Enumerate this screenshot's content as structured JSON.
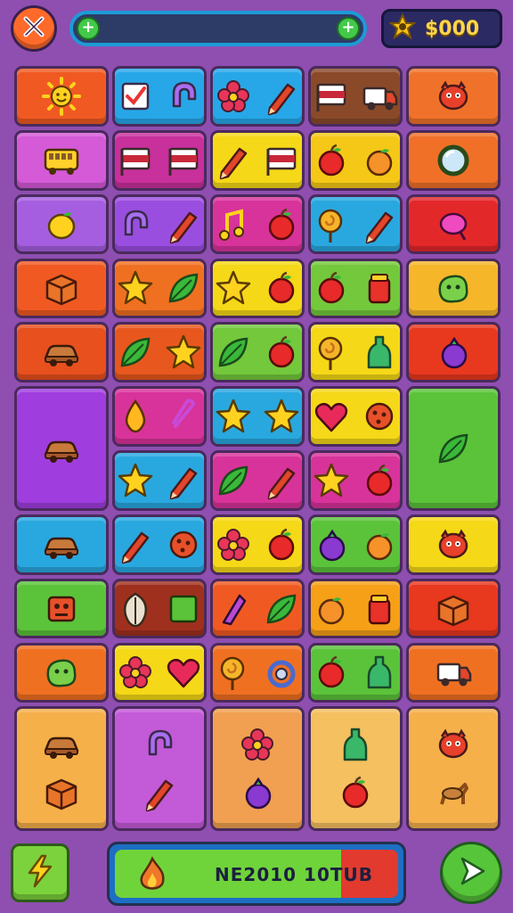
{
  "header": {
    "close_icon": "x-icon",
    "level_progress": 0.0,
    "progress_left_icon": "plus-icon",
    "progress_right_icon": "plus-icon",
    "coin_icon": "star-badge-icon",
    "coins": "$000"
  },
  "board": {
    "columns": 5,
    "tiles": [
      {
        "row": 0,
        "col": 0,
        "color": "#f05a22",
        "icons": [
          "sun-icon"
        ]
      },
      {
        "row": 0,
        "col": 1,
        "color": "#27a7e8",
        "icons": [
          "checkbox-icon",
          "magnet-icon"
        ]
      },
      {
        "row": 0,
        "col": 2,
        "color": "#27a7e8",
        "icons": [
          "flower-icon",
          "pencil-icon"
        ]
      },
      {
        "row": 0,
        "col": 3,
        "color": "#8a4a2a",
        "icons": [
          "flag-icon",
          "truck-icon"
        ]
      },
      {
        "row": 0,
        "col": 4,
        "color": "#f0722a",
        "icons": [
          "creature-icon"
        ]
      },
      {
        "row": 1,
        "col": 0,
        "color": "#d45ad8",
        "icons": [
          "bus-icon"
        ]
      },
      {
        "row": 1,
        "col": 1,
        "color": "#c8309c",
        "icons": [
          "flag-icon",
          "flag-icon"
        ]
      },
      {
        "row": 1,
        "col": 2,
        "color": "#f5d817",
        "icons": [
          "pencil-icon",
          "flag-icon"
        ]
      },
      {
        "row": 1,
        "col": 3,
        "color": "#f5c817",
        "icons": [
          "apple-icon",
          "orange-icon"
        ]
      },
      {
        "row": 1,
        "col": 4,
        "color": "#f07028",
        "icons": [
          "mirror-icon"
        ]
      },
      {
        "row": 2,
        "col": 0,
        "color": "#a55ee0",
        "icons": [
          "lemon-icon"
        ]
      },
      {
        "row": 2,
        "col": 1,
        "color": "#9a4ee0",
        "icons": [
          "magnet-icon",
          "pencil-icon"
        ]
      },
      {
        "row": 2,
        "col": 2,
        "color": "#d8339a",
        "icons": [
          "note-icon",
          "apple-icon"
        ]
      },
      {
        "row": 2,
        "col": 3,
        "color": "#29a8e0",
        "icons": [
          "lollipop-icon",
          "pencil-icon"
        ]
      },
      {
        "row": 2,
        "col": 4,
        "color": "#e3282a",
        "icons": [
          "candy-icon"
        ]
      },
      {
        "row": 3,
        "col": 0,
        "color": "#f05a22",
        "icons": [
          "box-icon"
        ]
      },
      {
        "row": 3,
        "col": 1,
        "color": "#f07022",
        "icons": [
          "star-icon",
          "leaf-icon"
        ]
      },
      {
        "row": 3,
        "col": 2,
        "color": "#f5d817",
        "icons": [
          "star-icon",
          "apple-icon"
        ]
      },
      {
        "row": 3,
        "col": 3,
        "color": "#73c83c",
        "icons": [
          "apple-icon",
          "jar-icon"
        ]
      },
      {
        "row": 3,
        "col": 4,
        "color": "#f5b62a",
        "icons": [
          "blob-icon"
        ]
      },
      {
        "row": 4,
        "col": 0,
        "color": "#e8501e",
        "icons": [
          "car-icon"
        ]
      },
      {
        "row": 4,
        "col": 1,
        "color": "#e8581e",
        "icons": [
          "leaf-icon",
          "star-icon"
        ]
      },
      {
        "row": 4,
        "col": 2,
        "color": "#73c83c",
        "icons": [
          "leaf-icon",
          "apple-icon"
        ]
      },
      {
        "row": 4,
        "col": 3,
        "color": "#f5d817",
        "icons": [
          "lollipop-icon",
          "bottle-icon"
        ]
      },
      {
        "row": 4,
        "col": 4,
        "color": "#e8381e",
        "icons": [
          "berry-icon"
        ]
      },
      {
        "row": 5,
        "col": 0,
        "color": "#9f3ddf",
        "icons": [
          "car-icon"
        ],
        "tall": true
      },
      {
        "row": 5,
        "col": 1,
        "color": "#d8339a",
        "icons": [
          "drop-icon",
          "paperclip-icon"
        ]
      },
      {
        "row": 5,
        "col": 2,
        "color": "#29a8e0",
        "icons": [
          "star-icon",
          "star-icon"
        ]
      },
      {
        "row": 5,
        "col": 3,
        "color": "#f5d817",
        "icons": [
          "heart-icon",
          "cookie-icon"
        ]
      },
      {
        "row": 5,
        "col": 4,
        "color": "#5bc33a",
        "icons": [
          "leaf-icon"
        ],
        "tall": true
      },
      {
        "row": 6,
        "col": 1,
        "color": "#29a8e0",
        "icons": [
          "star-icon",
          "pencil-icon"
        ]
      },
      {
        "row": 6,
        "col": 2,
        "color": "#d8339a",
        "icons": [
          "leaf-icon",
          "pencil-icon"
        ]
      },
      {
        "row": 6,
        "col": 3,
        "color": "#d8339a",
        "icons": [
          "star-icon",
          "apple-icon"
        ]
      },
      {
        "row": 7,
        "col": 0,
        "color": "#29a8e0",
        "icons": [
          "car-icon"
        ]
      },
      {
        "row": 7,
        "col": 1,
        "color": "#29a8e0",
        "icons": [
          "pencil-icon",
          "cookie-icon"
        ]
      },
      {
        "row": 7,
        "col": 2,
        "color": "#f5d817",
        "icons": [
          "flower-icon",
          "apple-icon"
        ]
      },
      {
        "row": 7,
        "col": 3,
        "color": "#5bc33a",
        "icons": [
          "berry-icon",
          "orange-icon"
        ]
      },
      {
        "row": 7,
        "col": 4,
        "color": "#f5d817",
        "icons": [
          "creature-icon"
        ]
      },
      {
        "row": 8,
        "col": 0,
        "color": "#5bc33a",
        "icons": [
          "robot-icon"
        ]
      },
      {
        "row": 8,
        "col": 1,
        "color": "#a0301e",
        "icons": [
          "shell-icon",
          "square-icon"
        ]
      },
      {
        "row": 8,
        "col": 2,
        "color": "#f05a22",
        "icons": [
          "sail-icon",
          "leaf-icon"
        ]
      },
      {
        "row": 8,
        "col": 3,
        "color": "#f5a017",
        "icons": [
          "orange-icon",
          "jar-icon"
        ]
      },
      {
        "row": 8,
        "col": 4,
        "color": "#e8381e",
        "icons": [
          "box-icon"
        ]
      },
      {
        "row": 9,
        "col": 0,
        "color": "#f07022",
        "icons": [
          "blob-icon"
        ]
      },
      {
        "row": 9,
        "col": 1,
        "color": "#f5d817",
        "icons": [
          "flower-icon",
          "heart-icon"
        ]
      },
      {
        "row": 9,
        "col": 2,
        "color": "#f07022",
        "icons": [
          "lollipop-icon",
          "ring-icon"
        ]
      },
      {
        "row": 9,
        "col": 3,
        "color": "#5bc33a",
        "icons": [
          "apple-icon",
          "bottle-icon"
        ]
      },
      {
        "row": 9,
        "col": 4,
        "color": "#f07022",
        "icons": [
          "truck-icon"
        ]
      },
      {
        "row": 10,
        "col": 0,
        "color": "#f5b04a",
        "icons": [
          "car-icon",
          "box-icon"
        ],
        "tall": true
      },
      {
        "row": 10,
        "col": 1,
        "color": "#c35ad8",
        "icons": [
          "magnet-icon",
          "pencil-icon"
        ],
        "tall": true
      },
      {
        "row": 10,
        "col": 2,
        "color": "#f0a050",
        "icons": [
          "flower-icon",
          "berry-icon"
        ],
        "tall": true
      },
      {
        "row": 10,
        "col": 3,
        "color": "#f5c060",
        "icons": [
          "bottle-icon",
          "apple-icon"
        ],
        "tall": true
      },
      {
        "row": 10,
        "col": 4,
        "color": "#f5b04a",
        "icons": [
          "creature-icon",
          "deer-icon"
        ],
        "tall": true
      }
    ]
  },
  "footer": {
    "lightning_button_icon": "lightning-icon",
    "power_icon": "flame-icon",
    "power_fill": 0.8,
    "power_label": "NE2010 10TUB",
    "play_button_icon": "play-icon"
  }
}
